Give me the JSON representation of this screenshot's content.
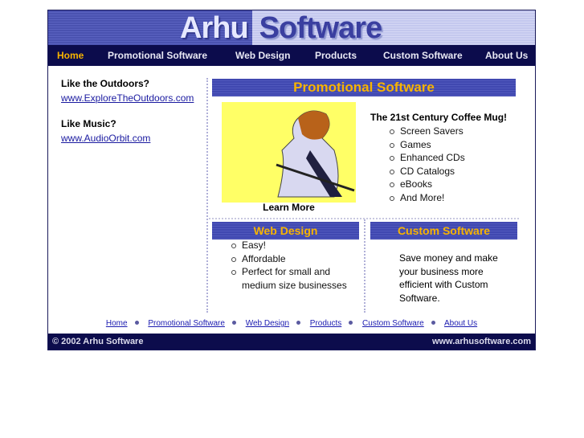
{
  "header": {
    "logo_part1": "Arhu",
    "logo_part2": "Software"
  },
  "nav": [
    {
      "label": "Home",
      "active": true
    },
    {
      "label": "Promotional Software"
    },
    {
      "label": "Web Design"
    },
    {
      "label": "Products"
    },
    {
      "label": "Custom Software"
    },
    {
      "label": "About Us"
    }
  ],
  "sidebar": [
    {
      "heading": "Like the Outdoors?",
      "link": "www.ExploreTheOutdoors.com"
    },
    {
      "heading": "Like Music?",
      "link": "www.AudioOrbit.com"
    }
  ],
  "promo": {
    "title": "Promotional Software",
    "image_caption": "Learn More",
    "headline": "The 21st Century Coffee Mug!",
    "items": [
      "Screen Savers",
      "Games",
      "Enhanced CDs",
      "CD Catalogs",
      "eBooks",
      "And More!"
    ]
  },
  "web_design": {
    "title": "Web Design",
    "items": [
      "Easy!",
      "Affordable",
      "Perfect for small and medium size businesses"
    ]
  },
  "custom": {
    "title": "Custom Software",
    "text": "Save money and make your business more efficient with Custom Software."
  },
  "footer_links": [
    "Home",
    "Promotional Software",
    "Web Design",
    "Products",
    "Custom Software",
    "About Us"
  ],
  "footer": {
    "copyright": "© 2002 Arhu Software",
    "url": "www.arhusoftware.com"
  },
  "colors": {
    "nav_bg": "#0c0c4c",
    "accent": "#f8b400",
    "header_band": "#4a52b0"
  }
}
